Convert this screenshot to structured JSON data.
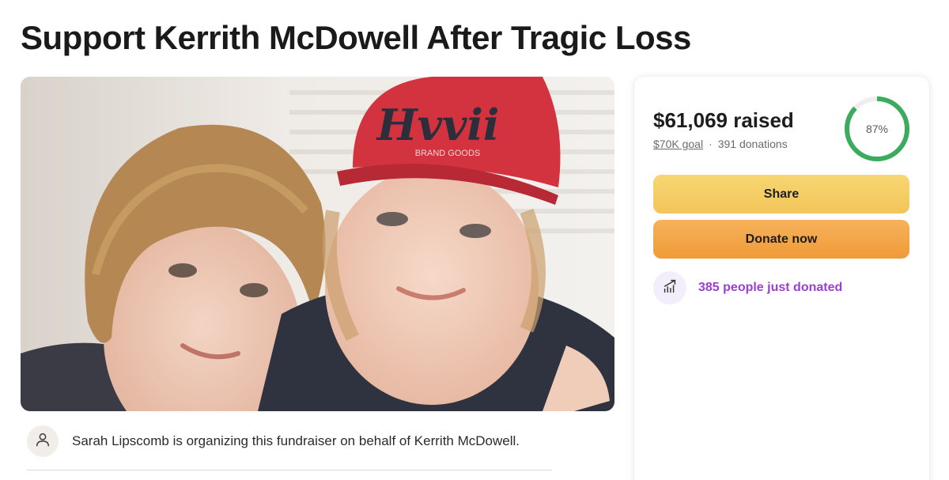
{
  "page": {
    "title": "Support Kerrith McDowell After Tragic Loss"
  },
  "hero": {
    "cap_text": "Hvvii",
    "cap_subtext": "BRAND GOODS"
  },
  "organizer": {
    "text": "Sarah Lipscomb is organizing this fundraiser on behalf of Kerrith McDowell.",
    "avatar_icon": "person-icon"
  },
  "donation": {
    "raised": "$61,069 raised",
    "goal": "$70K goal",
    "separator": "·",
    "donations": "391 donations",
    "progress_percent": 87,
    "progress_label": "87%",
    "share_label": "Share",
    "donate_label": "Donate now",
    "recent_text": "385 people just donated",
    "recent_icon": "trending-up-icon"
  },
  "colors": {
    "progress": "#3bab5d",
    "progress_track": "#eeeeee",
    "share_button": "#f4cb62",
    "donate_button": "#f2a444",
    "recent_text": "#9b3fd4"
  }
}
